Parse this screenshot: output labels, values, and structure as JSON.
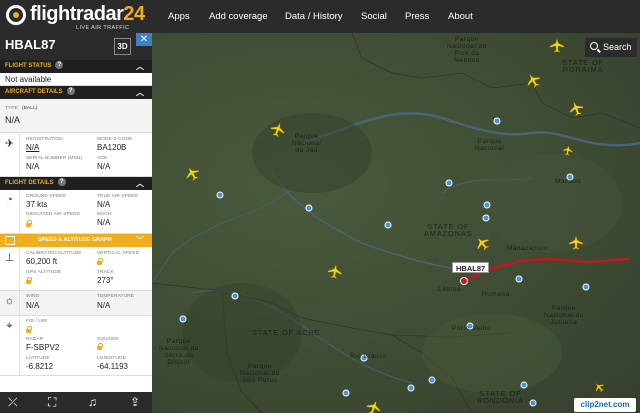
{
  "brand": {
    "name_a": "flightradar",
    "name_b": "24",
    "tagline": "LIVE AIR TRAFFIC"
  },
  "nav": [
    "Apps",
    "Add coverage",
    "Data / History",
    "Social",
    "Press",
    "About"
  ],
  "search": {
    "label": "Search"
  },
  "panel": {
    "callsign": "HBAL87",
    "btn_3d": "3D",
    "close": "✕",
    "flight_status": {
      "title": "FLIGHT STATUS",
      "value": "Not available"
    },
    "aircraft": {
      "title": "AIRCRAFT DETAILS",
      "type_label": "TYPE",
      "type_code": "(BALL)",
      "type_value": "N/A",
      "registration_label": "REGISTRATION",
      "registration": "N/A",
      "modes_label": "MODE-S CODE",
      "modes": "BA120B",
      "serial_label": "SERIAL NUMBER (MSN)",
      "serial": "N/A",
      "age_label": "AGE",
      "age": "N/A"
    },
    "flight": {
      "title": "FLIGHT DETAILS",
      "ground_speed_label": "GROUND SPEED",
      "ground_speed": "37 kts",
      "true_airspeed_label": "TRUE AIR SPEED",
      "true_airspeed": "N/A",
      "indicated_label": "INDICATED AIR SPEED",
      "mach_label": "MACH",
      "mach": "N/A",
      "graph_label": "SPEED & ALTITUDE GRAPH",
      "cal_alt_label": "CALIBRATED ALTITUDE",
      "cal_alt": "60,200 ft",
      "vert_speed_label": "VERTICAL SPEED",
      "gps_alt_label": "GPS ALTITUDE",
      "track_label": "TRACK",
      "track": "273°",
      "wind_label": "WIND",
      "wind": "N/A",
      "temp_label": "TEMPERATURE",
      "temp": "N/A",
      "fir_label": "FIR / UIR",
      "radar_label": "RADAR",
      "radar": "F-SBPV2",
      "squawk_label": "SQUAWK",
      "lat_label": "LATITUDE",
      "lat": "-6.8212",
      "lon_label": "LONGITUDE",
      "lon": "-64.1193"
    }
  },
  "map": {
    "labels": {
      "roraima": "STATE OF\nRORAIMA",
      "amazonas": "STATE OF\nAMAZONAS",
      "acre": "STATE OF ACRE",
      "rondonia": "STATE OF\nRONDÔNIA",
      "pico_neblina": "Parque\nNacional do\nPico da\nNeblina",
      "jau": "Parque\nNacional\ndo Jaú",
      "serra_divisor": "Parque\nNacional da\nSerra do\nDivisor",
      "parque_nacional": "Parque\nNacional",
      "juruena": "Parque\nNacional do\nJuruena",
      "alto_purus": "Parque\nNacional do\nAlto Purus",
      "manaus": "Manaus",
      "manacapuru": "Manacapuru",
      "labrea": "Lábrea",
      "humaita": "Humaitá",
      "porto_velho": "Porto Velho",
      "rio_branco": "Rio Branco"
    },
    "callsign_tag": "HBAL87"
  },
  "watermark": "clip2net.com"
}
